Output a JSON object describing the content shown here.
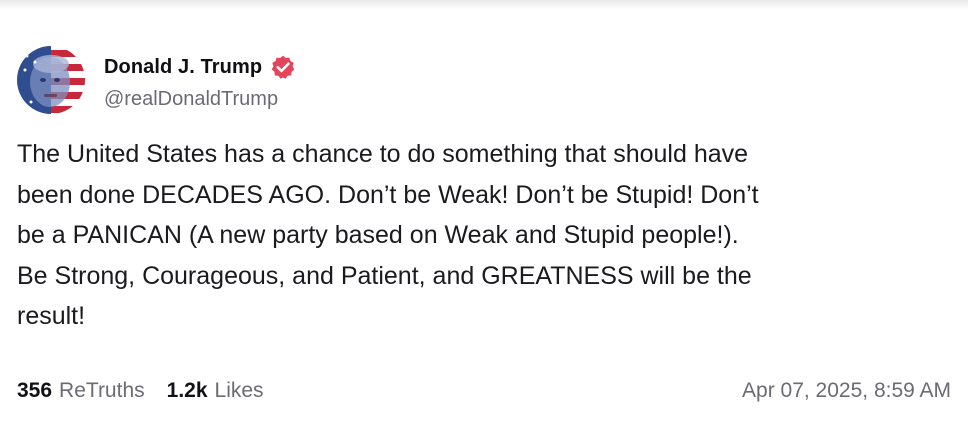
{
  "post": {
    "author": {
      "display_name": "Donald J. Trump",
      "handle": "@realDonaldTrump",
      "verified": true,
      "avatar": "flag-portrait-avatar"
    },
    "text": "The United States has a chance to do something that should have\nbeen done DECADES AGO. Don’t be Weak! Don’t be Stupid! Don’t\nbe a PANICAN (A new party based on Weak and Stupid people!).\nBe Strong, Courageous, and Patient, and GREATNESS will be the\nresult!",
    "stats": {
      "retruths_count": "356",
      "retruths_label": "ReTruths",
      "likes_count": "1.2k",
      "likes_label": "Likes"
    },
    "timestamp": "Apr 07, 2025, 8:59 AM"
  },
  "colors": {
    "verified_badge": "#e5455a",
    "text": "#1a1a1f",
    "muted": "#6b6b75"
  },
  "icons": {
    "verified": "verified-badge-icon"
  }
}
